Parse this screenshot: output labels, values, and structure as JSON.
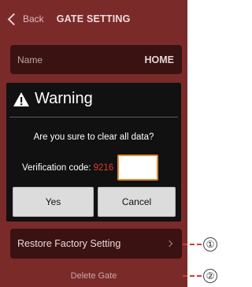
{
  "header": {
    "back_label": "Back",
    "title": "GATE SETTING"
  },
  "name_row": {
    "label": "Name",
    "value": "HOME"
  },
  "dialog": {
    "title": "Warning",
    "message": "Are you sure to clear all data?",
    "verification_label": "Verification code:",
    "verification_code": "9216",
    "verification_input_value": "",
    "yes_label": "Yes",
    "cancel_label": "Cancel"
  },
  "restore_row": {
    "label": "Restore Factory Setting"
  },
  "delete_row": {
    "label": "Delete Gate"
  },
  "callouts": [
    "①",
    "②"
  ],
  "colors": {
    "background": "#7b2a2a",
    "row": "#3a1212",
    "dialog": "#111111",
    "code": "#e23a2e",
    "input_border": "#e08a30",
    "callout_line": "#d23b2f"
  }
}
